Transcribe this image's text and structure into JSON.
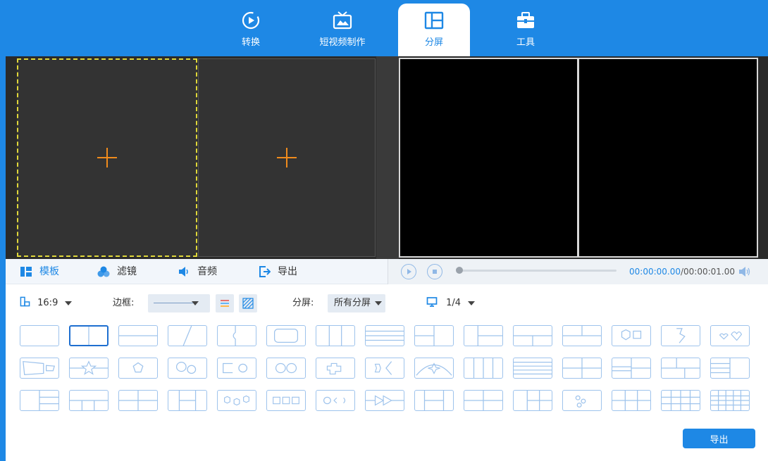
{
  "nav": {
    "tabs": [
      {
        "label": "转换",
        "icon": "convert-icon"
      },
      {
        "label": "短视频制作",
        "icon": "tv-icon"
      },
      {
        "label": "分屏",
        "icon": "split-screen-icon",
        "active": true
      },
      {
        "label": "工具",
        "icon": "toolbox-icon"
      }
    ]
  },
  "subtabs": [
    {
      "label": "模板",
      "icon": "template-icon",
      "active": true
    },
    {
      "label": "滤镜",
      "icon": "filter-icon"
    },
    {
      "label": "音频",
      "icon": "speaker-icon"
    },
    {
      "label": "导出",
      "icon": "export-icon"
    }
  ],
  "player": {
    "current_time": "00:00:00.00",
    "duration": "/00:00:01.00",
    "progress": 0
  },
  "settings": {
    "ratio": "16:9",
    "border_label": "边框:",
    "split_label": "分屏:",
    "split_value": "所有分屏",
    "page": "1/4"
  },
  "templates": {
    "count": 45,
    "selected_index": 1
  },
  "export_button": "导出",
  "colors": {
    "accent": "#1e88e5",
    "plus": "#f08b1c",
    "template_border": "#9ec3ec"
  }
}
